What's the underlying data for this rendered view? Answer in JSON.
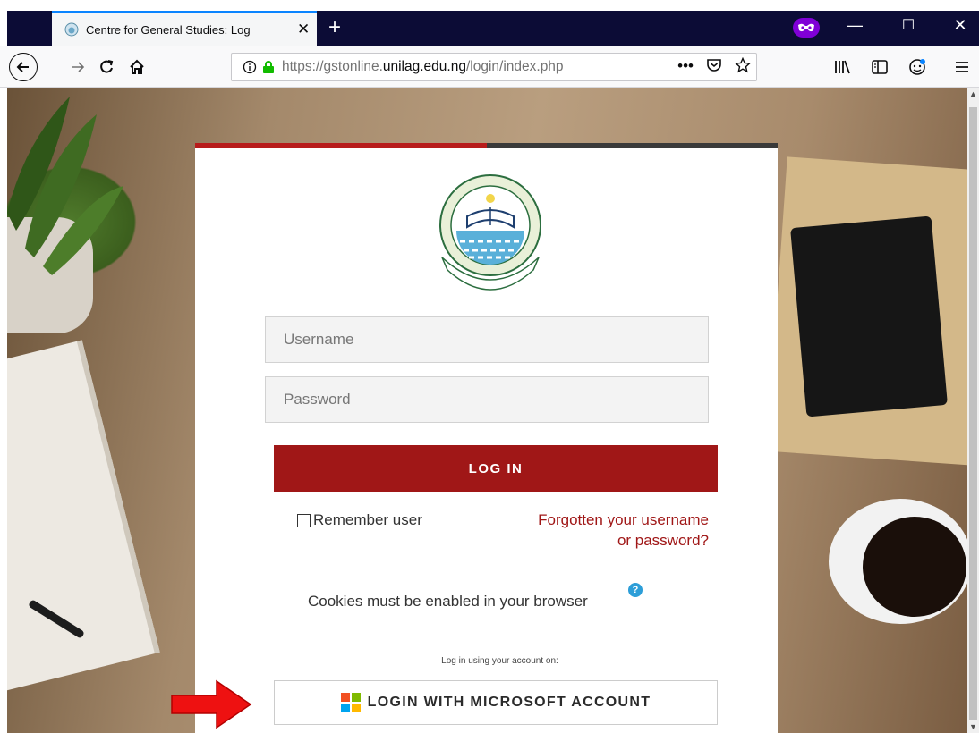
{
  "browser": {
    "tab_title": "Centre for General Studies: Log",
    "tab_close": "✕",
    "new_tab": "+",
    "url_prefix": "https://gstonline.",
    "url_domain": "unilag.edu.ng",
    "url_path": "/login/index.php",
    "more_actions": "•••",
    "window_controls": {
      "minimize": "—",
      "maximize": "☐",
      "close": "✕"
    }
  },
  "login": {
    "username_placeholder": "Username",
    "password_placeholder": "Password",
    "login_button": "LOG IN",
    "remember_label": "Remember user",
    "forgot_line1": "Forgotten your username",
    "forgot_line2": "or password?",
    "cookies_text": "Cookies must be enabled in your browser",
    "login_using": "Log in using your account on:",
    "microsoft_button": "LOGIN WITH MICROSOFT ACCOUNT"
  },
  "logo": {
    "name": "UNIVERSITY OF LAGOS",
    "motto": "IN DEED AND IN TRUTH"
  },
  "colors": {
    "accent_red": "#a01717",
    "help_blue": "#2d9ed8",
    "ms_red": "#f25022",
    "ms_green": "#7fba00",
    "ms_blue": "#00a4ef",
    "ms_yellow": "#ffb900"
  },
  "icons": [
    "back-icon",
    "forward-icon",
    "reload-icon",
    "home-icon",
    "info-icon",
    "lock-icon",
    "pocket-icon",
    "bookmark-star-icon",
    "library-icon",
    "sidebar-icon",
    "profile-icon",
    "menu-icon",
    "help-icon",
    "microsoft-logo-icon",
    "red-arrow-icon"
  ]
}
